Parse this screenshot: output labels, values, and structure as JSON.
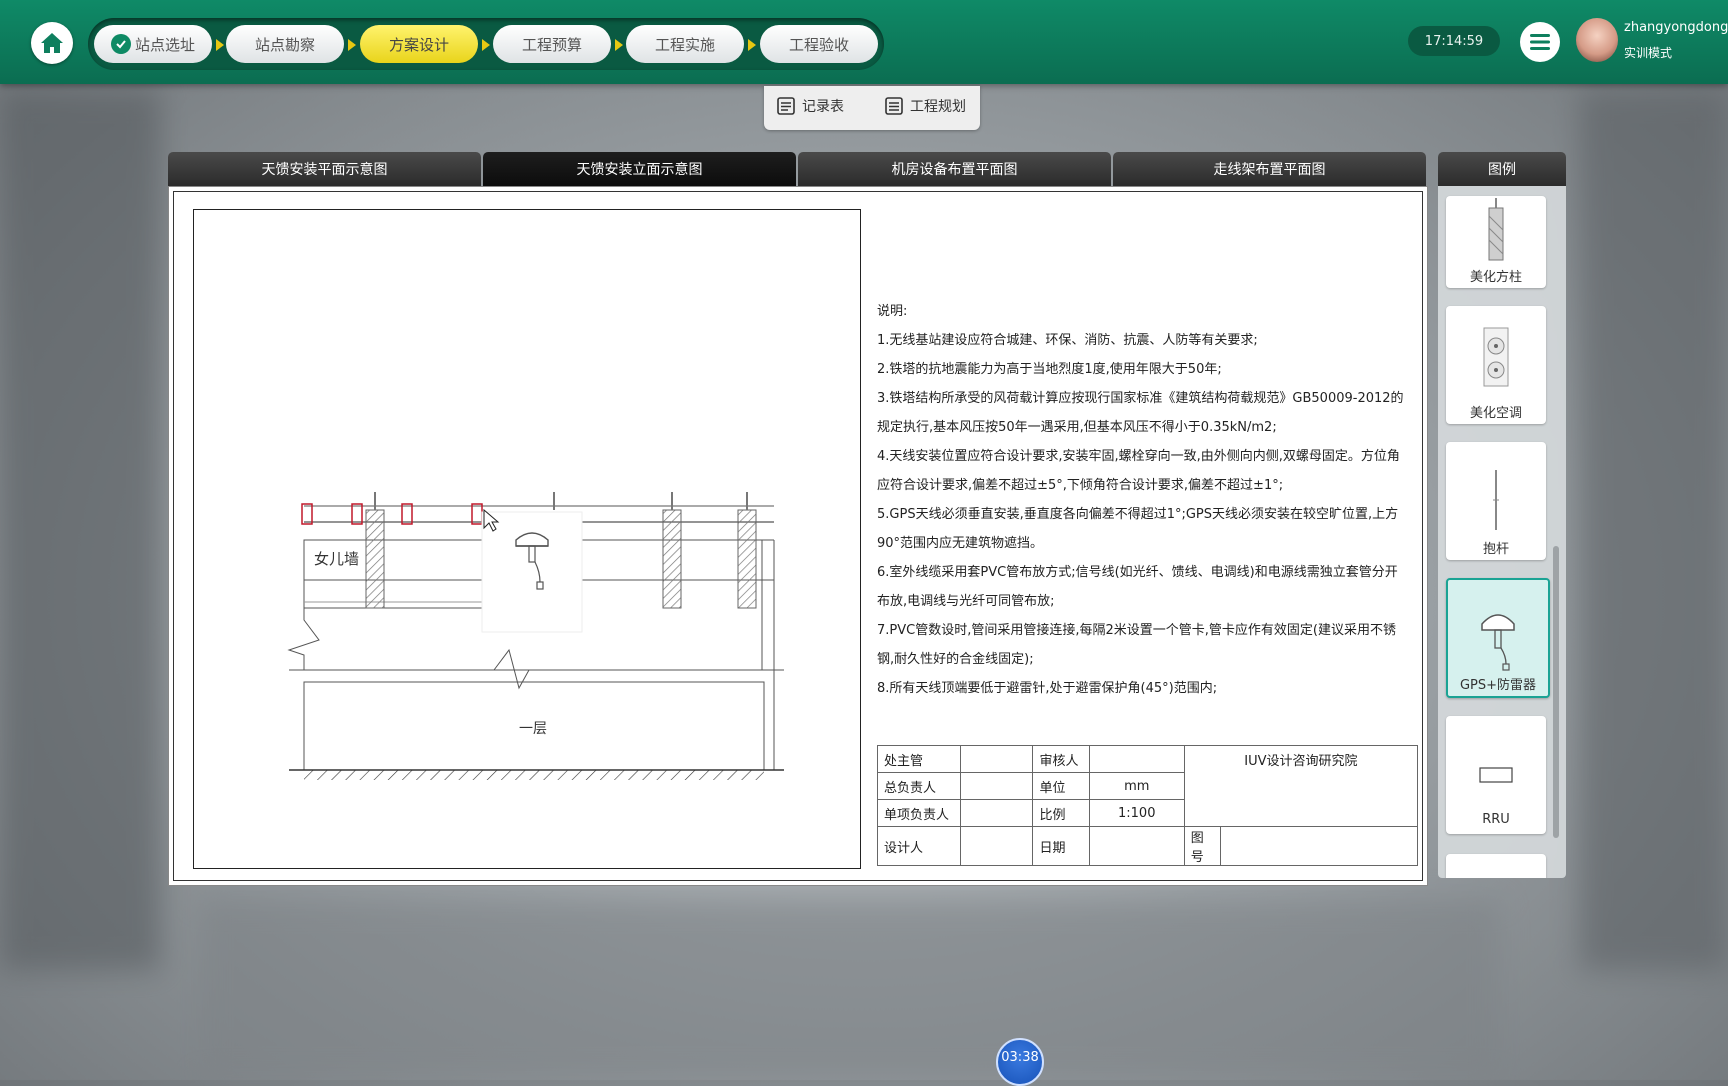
{
  "header": {
    "steps": [
      {
        "label": "站点选址",
        "done": true
      },
      {
        "label": "站点勘察",
        "done": false
      },
      {
        "label": "方案设计",
        "active": true
      },
      {
        "label": "工程预算",
        "done": false
      },
      {
        "label": "工程实施",
        "done": false
      },
      {
        "label": "工程验收",
        "done": false
      }
    ],
    "clock": "17:14:59",
    "user": {
      "name": "zhangyongdong",
      "mode": "实训模式"
    }
  },
  "subtabs": [
    {
      "label": "记录表"
    },
    {
      "label": "工程规划"
    }
  ],
  "drawing_tabs": [
    {
      "label": "天馈安装平面示意图"
    },
    {
      "label": "天馈安装立面示意图",
      "selected": true
    },
    {
      "label": "机房设备布置平面图"
    },
    {
      "label": "走线架布置平面图"
    }
  ],
  "drawing": {
    "wall_label": "女儿墙",
    "floor_label": "一层"
  },
  "notes": {
    "title": "说明:",
    "lines": [
      "1.无线基站建设应符合城建、环保、消防、抗震、人防等有关要求;",
      "2.铁塔的抗地震能力为高于当地烈度1度,使用年限大于50年;",
      "3.铁塔结构所承受的风荷载计算应按现行国家标准《建筑结构荷载规范》GB50009-2012的规定执行,基本风压按50年一遇采用,但基本风压不得小于0.35kN/m2;",
      "4.天线安装位置应符合设计要求,安装牢固,螺栓穿向一致,由外侧向内侧,双螺母固定。方位角应符合设计要求,偏差不超过±5°,下倾角符合设计要求,偏差不超过±1°;",
      "5.GPS天线必须垂直安装,垂直度各向偏差不得超过1°;GPS天线必须安装在较空旷位置,上方90°范围内应无建筑物遮挡。",
      "6.室外线缆采用套PVC管布放方式;信号线(如光纤、馈线、电调线)和电源线需独立套管分开布放,电调线与光纤可同管布放;",
      "7.PVC管数设时,管间采用管接连接,每隔2米设置一个管卡,管卡应作有效固定(建议采用不锈钢,耐久性好的合金线固定);",
      "8.所有天线顶端要低于避雷针,处于避雷保护角(45°)范围内;"
    ]
  },
  "title_block": {
    "r1": {
      "a": "处主管",
      "b": "",
      "c": "审核人",
      "d": "",
      "e": "IUV设计咨询研究院"
    },
    "r2": {
      "a": "总负责人",
      "b": "",
      "c": "单位",
      "d": "mm"
    },
    "r3": {
      "a": "单项负责人",
      "b": "",
      "c": "比例",
      "d": "1:100"
    },
    "r4": {
      "a": "设计人",
      "b": "",
      "c": "日期",
      "d": "",
      "e": "图号",
      "f": ""
    }
  },
  "legend": {
    "title": "图例",
    "items": [
      {
        "label": "美化方柱"
      },
      {
        "label": "美化空调"
      },
      {
        "label": "抱杆"
      },
      {
        "label": "GPS+防雷器",
        "selected": true
      },
      {
        "label": "RRU"
      }
    ]
  },
  "timer": "03:38",
  "colors": {
    "brand": "#0b7a5a",
    "active_step": "#f0dc2a",
    "selected_legend": "#1aa394"
  }
}
